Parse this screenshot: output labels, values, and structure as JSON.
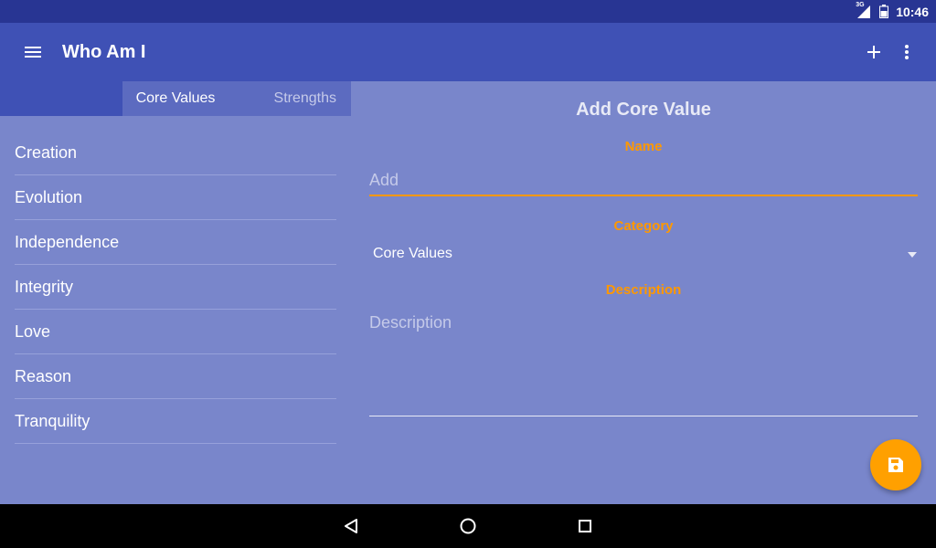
{
  "status_bar": {
    "time": "10:46",
    "network": "3G",
    "icons": [
      "signal-icon",
      "battery-icon"
    ]
  },
  "toolbar": {
    "title": "Who Am I",
    "icons": [
      "hamburger-menu-icon",
      "add-icon",
      "more-vert-icon"
    ]
  },
  "tabs": [
    {
      "label": "Core Values",
      "active": true
    },
    {
      "label": "Strengths",
      "active": false
    }
  ],
  "list": {
    "items": [
      "Creation",
      "Evolution",
      "Independence",
      "Integrity",
      "Love",
      "Reason",
      "Tranquility"
    ]
  },
  "form": {
    "title": "Add Core Value",
    "name_label": "Name",
    "name_placeholder": "Add",
    "category_label": "Category",
    "category_value": "Core Values",
    "description_label": "Description",
    "description_placeholder": "Description"
  },
  "fab": {
    "icon": "save-icon"
  },
  "nav_bar": {
    "icons": [
      "back-icon",
      "home-icon",
      "recents-icon"
    ]
  },
  "colors": {
    "primary": "#3F51B5",
    "primary_dark": "#283593",
    "background": "#7986CB",
    "accent": "#FF9800",
    "fab": "#FFA000"
  }
}
